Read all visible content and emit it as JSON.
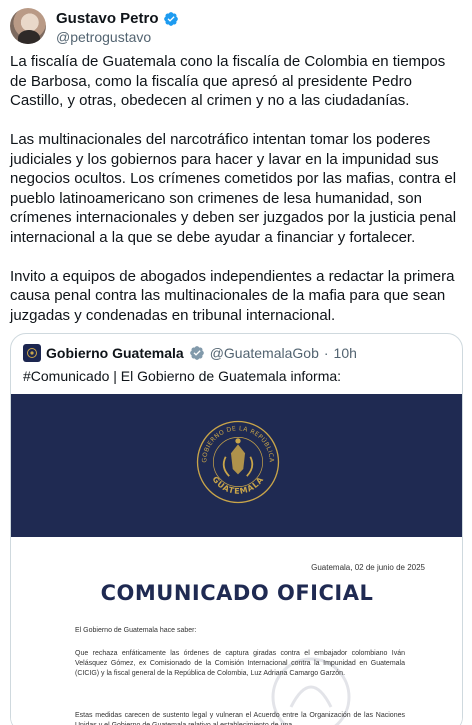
{
  "author": {
    "name": "Gustavo Petro",
    "handle": "@petrogustavo"
  },
  "tweet": {
    "paragraphs": [
      "La fiscalía de Guatemala cono la fiscalía de Colombia en tiempos de Barbosa, como la fiscalía que apresó al presidente Pedro Castillo, y otras, obedecen al crimen y no a las ciudadanías.",
      "Las multinacionales del narcotráfico intentan tomar los poderes judiciales y los gobiernos para hacer y lavar en la impunidad sus negocios ocultos. Los crímenes  cometidos por las mafias, contra el pueblo latinoamericano son crimenes de lesa humanidad, son crímenes internacionales y deben ser juzgados por la justicia penal internacional a la que se debe ayudar a financiar y fortalecer.",
      "Invito a equipos de abogados independientes a redactar la primera causa penal contra las multinacionales de la mafia para que sean juzgadas y condenadas en tribunal internacional."
    ]
  },
  "quoted": {
    "name": "Gobierno Guatemala",
    "handle": "@GuatemalaGob",
    "separator": "·",
    "time": "10h",
    "text": "#Comunicado | El Gobierno de Guatemala informa:",
    "image": {
      "seal_top": "GOBIERNO DE LA REPÚBLICA",
      "seal_bottom": "GUATEMALA",
      "date": "Guatemala, 02 de junio de 2025",
      "title": "COMUNICADO OFICIAL",
      "intro": "El Gobierno de Guatemala hace saber:",
      "paragraph1": "Que rechaza enfáticamente  las órdenes de captura giradas contra el embajador colombiano Iván Velásquez Gómez, ex Comisionado de la Comisión Internacional contra la Impunidad en Guatemala (CICIG) y la fiscal general de la República de Colombia, Luz Adriana Camargo Garzón.",
      "paragraph2": "Estas medidas carecen de sustento legal y vulneran  el Acuerdo entre la Organización de las Naciones Unidas y el Gobierno de Guatemala relativo al establecimiento de una"
    }
  },
  "colors": {
    "verified": "#1d9bf0",
    "banner": "#1f2a52",
    "seal_gold": "#c9a54a",
    "secondary_text": "#536471"
  }
}
